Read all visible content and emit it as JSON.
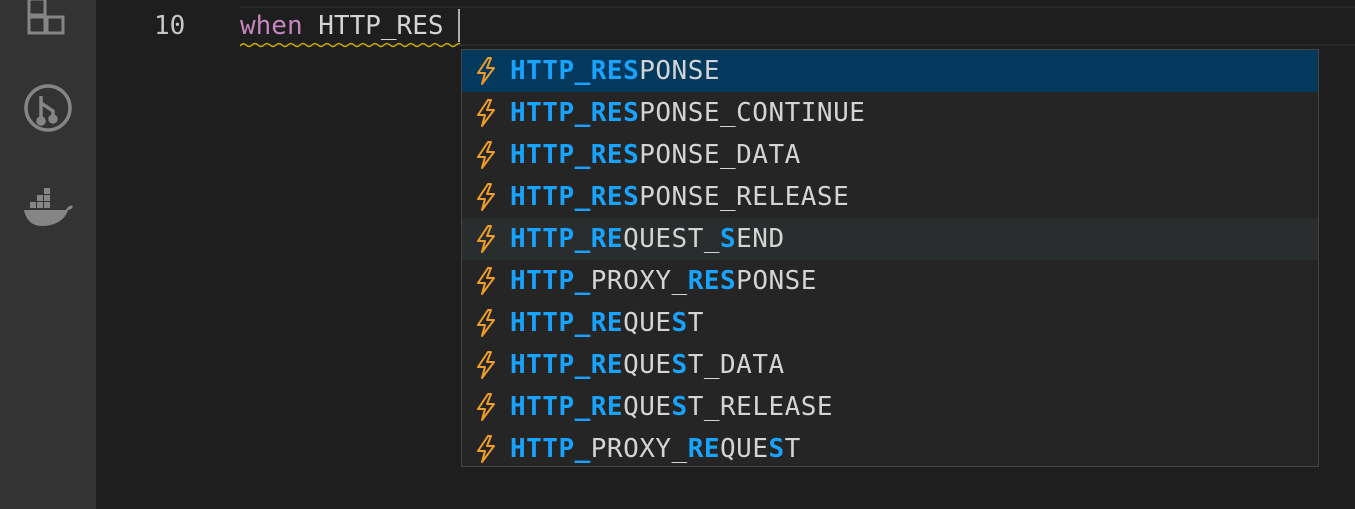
{
  "activity_bar": {
    "icons": [
      "extensions-icon",
      "git-graph-icon",
      "docker-icon"
    ]
  },
  "editor": {
    "line_number": "10",
    "code": {
      "keyword": "when",
      "rest": " HTTP_RES"
    }
  },
  "suggest": {
    "item_icon": "event-icon",
    "items": [
      {
        "label": "HTTP_RESPONSE",
        "segments": [
          {
            "t": "HTTP_RES",
            "h": true
          },
          {
            "t": "PONSE",
            "h": false
          }
        ]
      },
      {
        "label": "HTTP_RESPONSE_CONTINUE",
        "segments": [
          {
            "t": "HTTP_RES",
            "h": true
          },
          {
            "t": "PONSE_CONTINUE",
            "h": false
          }
        ]
      },
      {
        "label": "HTTP_RESPONSE_DATA",
        "segments": [
          {
            "t": "HTTP_RES",
            "h": true
          },
          {
            "t": "PONSE_DATA",
            "h": false
          }
        ]
      },
      {
        "label": "HTTP_RESPONSE_RELEASE",
        "segments": [
          {
            "t": "HTTP_RES",
            "h": true
          },
          {
            "t": "PONSE_RELEASE",
            "h": false
          }
        ]
      },
      {
        "label": "HTTP_REQUEST_SEND",
        "segments": [
          {
            "t": "HTTP_RE",
            "h": true
          },
          {
            "t": "QUEST_",
            "h": false
          },
          {
            "t": "S",
            "h": true
          },
          {
            "t": "END",
            "h": false
          }
        ]
      },
      {
        "label": "HTTP_PROXY_RESPONSE",
        "segments": [
          {
            "t": "HTTP_",
            "h": true
          },
          {
            "t": "PROXY_",
            "h": false
          },
          {
            "t": "RES",
            "h": true
          },
          {
            "t": "PONSE",
            "h": false
          }
        ]
      },
      {
        "label": "HTTP_REQUEST",
        "segments": [
          {
            "t": "HTTP_RE",
            "h": true
          },
          {
            "t": "QUE",
            "h": false
          },
          {
            "t": "S",
            "h": true
          },
          {
            "t": "T",
            "h": false
          }
        ]
      },
      {
        "label": "HTTP_REQUEST_DATA",
        "segments": [
          {
            "t": "HTTP_RE",
            "h": true
          },
          {
            "t": "QUE",
            "h": false
          },
          {
            "t": "S",
            "h": true
          },
          {
            "t": "T_DATA",
            "h": false
          }
        ]
      },
      {
        "label": "HTTP_REQUEST_RELEASE",
        "segments": [
          {
            "t": "HTTP_RE",
            "h": true
          },
          {
            "t": "QUE",
            "h": false
          },
          {
            "t": "S",
            "h": true
          },
          {
            "t": "T_RELEASE",
            "h": false
          }
        ]
      },
      {
        "label": "HTTP_PROXY_REQUEST",
        "segments": [
          {
            "t": "HTTP_",
            "h": true
          },
          {
            "t": "PROXY_",
            "h": false
          },
          {
            "t": "RE",
            "h": true
          },
          {
            "t": "QUE",
            "h": false
          },
          {
            "t": "S",
            "h": true
          },
          {
            "t": "T",
            "h": false
          }
        ]
      }
    ],
    "selected_index": 0,
    "hovered_index": 4
  },
  "colors": {
    "keyword": "#c586c0",
    "match_highlight": "#18a3ff",
    "icon": "#ee9d28",
    "squiggle": "#cca700",
    "selected_row": "#04395e"
  }
}
